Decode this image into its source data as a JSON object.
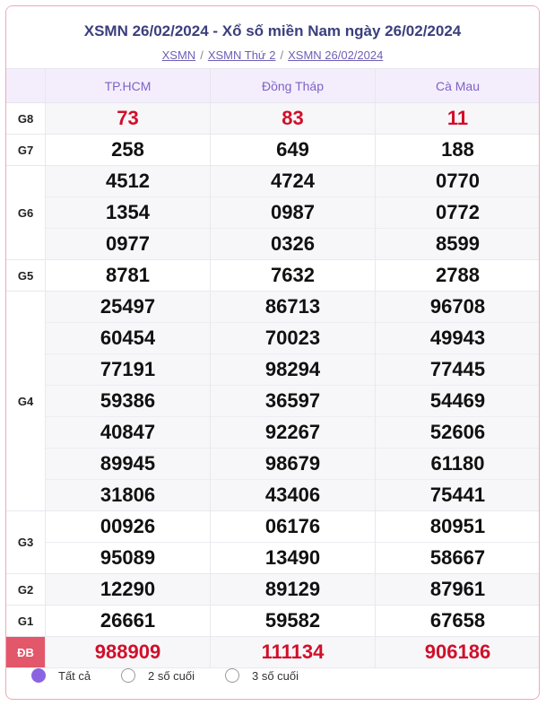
{
  "header": {
    "title": "XSMN 26/02/2024 - Xổ số miền Nam ngày 26/02/2024",
    "breadcrumb": [
      "XSMN",
      "XSMN Thứ 2",
      "XSMN 26/02/2024"
    ],
    "sep": "/"
  },
  "columns": [
    "TP.HCM",
    "Đồng Tháp",
    "Cà Mau"
  ],
  "prizes": [
    {
      "label": "G8",
      "rows": [
        [
          "73",
          "83",
          "11"
        ]
      ],
      "red": true
    },
    {
      "label": "G7",
      "rows": [
        [
          "258",
          "649",
          "188"
        ]
      ]
    },
    {
      "label": "G6",
      "rows": [
        [
          "4512",
          "4724",
          "0770"
        ],
        [
          "1354",
          "0987",
          "0772"
        ],
        [
          "0977",
          "0326",
          "8599"
        ]
      ]
    },
    {
      "label": "G5",
      "rows": [
        [
          "8781",
          "7632",
          "2788"
        ]
      ]
    },
    {
      "label": "G4",
      "rows": [
        [
          "25497",
          "86713",
          "96708"
        ],
        [
          "60454",
          "70023",
          "49943"
        ],
        [
          "77191",
          "98294",
          "77445"
        ],
        [
          "59386",
          "36597",
          "54469"
        ],
        [
          "40847",
          "92267",
          "52606"
        ],
        [
          "89945",
          "98679",
          "61180"
        ],
        [
          "31806",
          "43406",
          "75441"
        ]
      ]
    },
    {
      "label": "G3",
      "rows": [
        [
          "00926",
          "06176",
          "80951"
        ],
        [
          "95089",
          "13490",
          "58667"
        ]
      ]
    },
    {
      "label": "G2",
      "rows": [
        [
          "12290",
          "89129",
          "87961"
        ]
      ]
    },
    {
      "label": "G1",
      "rows": [
        [
          "26661",
          "59582",
          "67658"
        ]
      ]
    },
    {
      "label": "ĐB",
      "rows": [
        [
          "988909",
          "111134",
          "906186"
        ]
      ],
      "red": true,
      "special": true
    }
  ],
  "filters": [
    {
      "label": "Tất cả",
      "selected": true
    },
    {
      "label": "2 số cuối",
      "selected": false
    },
    {
      "label": "3 số cuối",
      "selected": false
    }
  ]
}
